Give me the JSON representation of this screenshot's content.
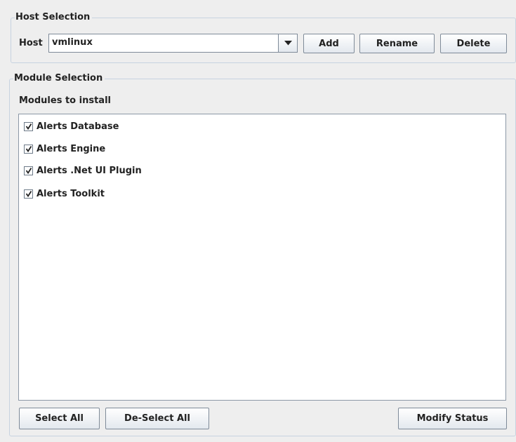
{
  "host_selection": {
    "legend": "Host Selection",
    "host_label": "Host",
    "host_value": "vmlinux",
    "add_label": "Add",
    "rename_label": "Rename",
    "delete_label": "Delete"
  },
  "module_selection": {
    "legend": "Module Selection",
    "modules_label": "Modules to install",
    "modules": [
      {
        "label": "Alerts Database",
        "checked": true
      },
      {
        "label": "Alerts Engine",
        "checked": true
      },
      {
        "label": "Alerts .Net UI Plugin",
        "checked": true
      },
      {
        "label": "Alerts Toolkit",
        "checked": true
      }
    ],
    "select_all_label": "Select All",
    "deselect_all_label": "De-Select All",
    "modify_status_label": "Modify Status"
  },
  "icons": {
    "dropdown": "chevron-down-icon",
    "checkbox": "checkmark-icon"
  }
}
